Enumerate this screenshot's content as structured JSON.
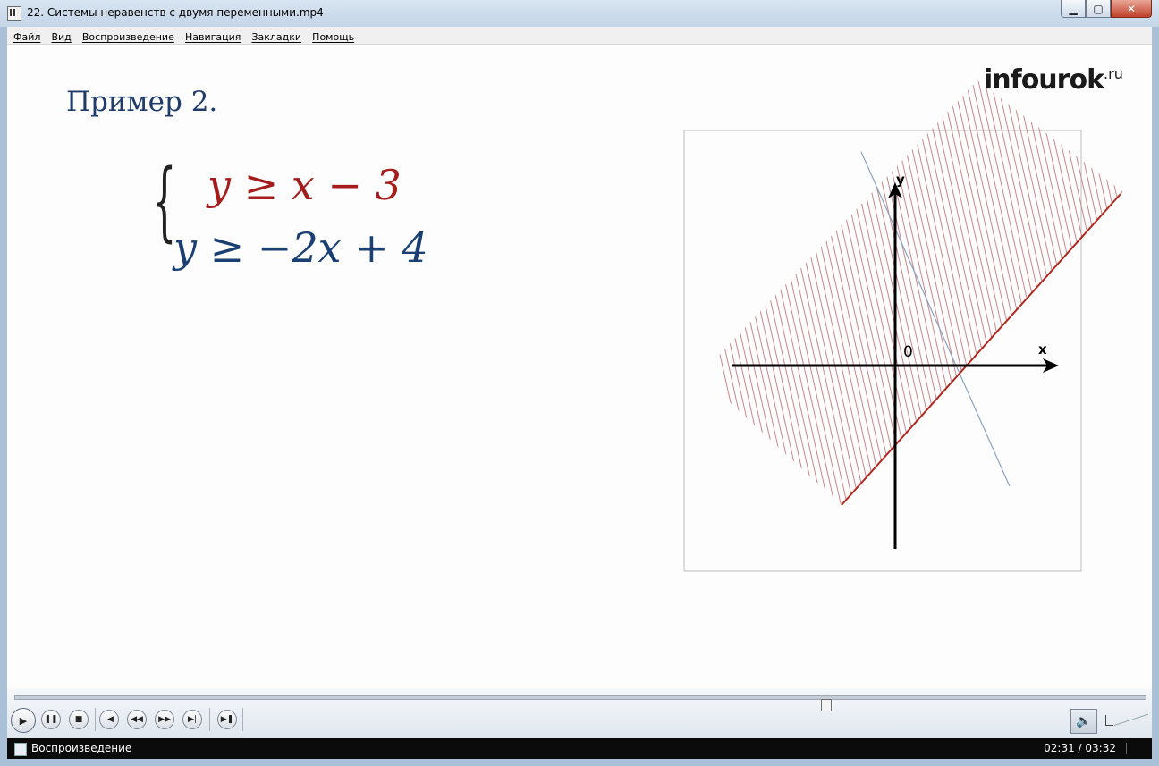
{
  "window": {
    "title": "22. Системы неравенств с двумя переменными.mp4",
    "min_glyph": "▁",
    "max_glyph": "▢",
    "close_glyph": "✕"
  },
  "menu": [
    "Файл",
    "Вид",
    "Воспроизведение",
    "Навигация",
    "Закладки",
    "Помощь"
  ],
  "slide": {
    "heading": "Пример 2.",
    "brace": "{",
    "inequality_1": "y ≥ x − 3",
    "inequality_2": "y ≥ −2x + 4",
    "logo": "infourok",
    "logo_suffix": ".ru",
    "graph": {
      "x_label": "x",
      "y_label": "y",
      "origin_label": "0",
      "line_1": "y = x − 3",
      "line_2": "y = −2x + 4",
      "line_1_color": "#b0281e",
      "line_2_color": "#8aa2c2",
      "hatch_color": "#c8868a",
      "axis_color": "#000000"
    }
  },
  "controls": {
    "play_icon": "▶",
    "pause_icon": "❚❚",
    "stop_icon": "■",
    "prev_icon": "|◀",
    "rewind_icon": "◀◀",
    "forward_icon": "▶▶",
    "next_icon": "▶|",
    "frame_icon": "▶❚",
    "mute_icon": "🔈",
    "progress": 0.7186
  },
  "status": {
    "state": "Воспроизведение",
    "time": "02:31 / 03:32"
  }
}
